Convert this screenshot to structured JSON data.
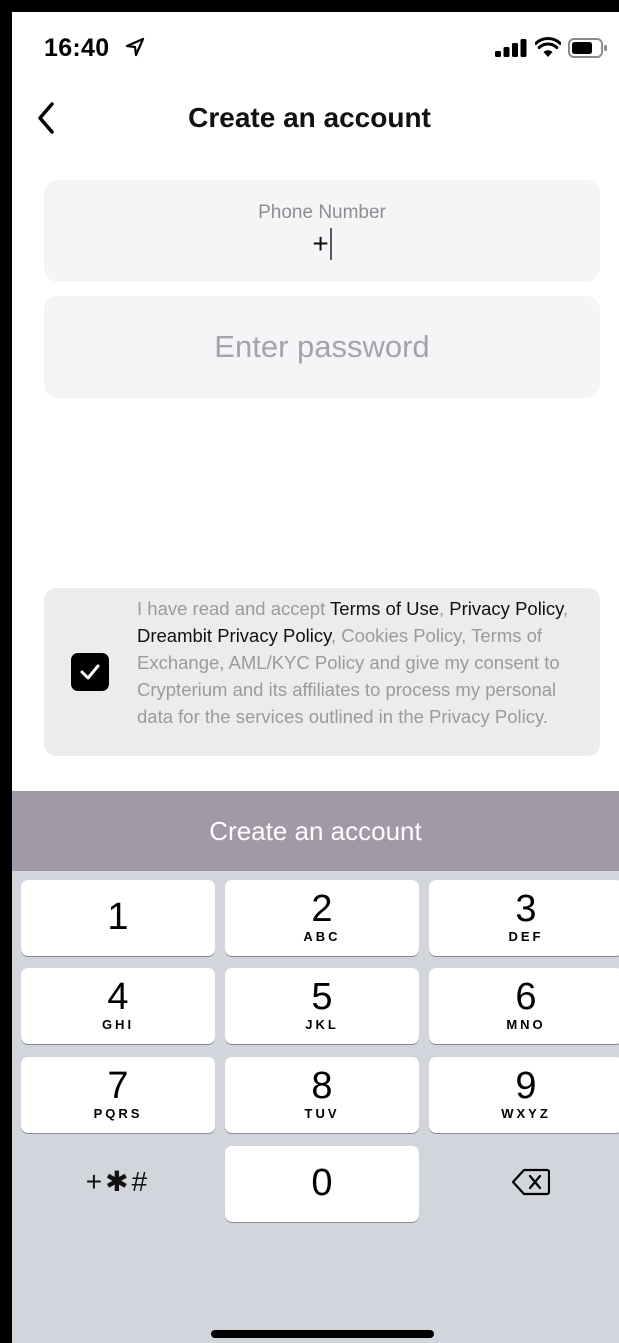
{
  "status_bar": {
    "time": "16:40"
  },
  "header": {
    "title": "Create an account"
  },
  "phone": {
    "label": "Phone Number",
    "value": "+"
  },
  "password": {
    "placeholder": "Enter password"
  },
  "consent": {
    "checked": true,
    "t1": "I have read and accept ",
    "terms_of_use": "Terms of Use",
    "sep1": ", ",
    "privacy_policy": "Privacy Policy",
    "sep2": ", ",
    "dreambit_policy": "Dreambit Privacy Policy",
    "t2": ", Cookies Policy, Terms of Exchange, AML/KYC Policy and give my consent to Crypterium and its affiliates to process my personal data for the services outlined in the Privacy Policy."
  },
  "create_button": {
    "label": "Create an account"
  },
  "keyboard": {
    "keys": [
      {
        "digit": "1",
        "letters": ""
      },
      {
        "digit": "2",
        "letters": "ABC"
      },
      {
        "digit": "3",
        "letters": "DEF"
      },
      {
        "digit": "4",
        "letters": "GHI"
      },
      {
        "digit": "5",
        "letters": "JKL"
      },
      {
        "digit": "6",
        "letters": "MNO"
      },
      {
        "digit": "7",
        "letters": "PQRS"
      },
      {
        "digit": "8",
        "letters": "TUV"
      },
      {
        "digit": "9",
        "letters": "WXYZ"
      },
      {
        "digit": "0",
        "letters": ""
      }
    ],
    "symbols": "+✱#"
  }
}
